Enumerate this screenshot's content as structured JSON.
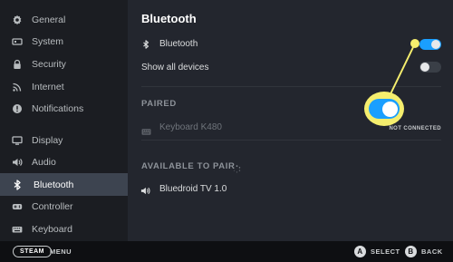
{
  "sidebar": {
    "items": [
      {
        "label": "General",
        "icon": "gear-icon",
        "active": false
      },
      {
        "label": "System",
        "icon": "system-icon",
        "active": false
      },
      {
        "label": "Security",
        "icon": "lock-icon",
        "active": false
      },
      {
        "label": "Internet",
        "icon": "wifi-icon",
        "active": false
      },
      {
        "label": "Notifications",
        "icon": "notification-icon",
        "active": false
      },
      {
        "label": "Display",
        "icon": "monitor-icon",
        "active": false
      },
      {
        "label": "Audio",
        "icon": "speaker-icon",
        "active": false
      },
      {
        "label": "Bluetooth",
        "icon": "bluetooth-icon",
        "active": true
      },
      {
        "label": "Controller",
        "icon": "gamepad-icon",
        "active": false
      },
      {
        "label": "Keyboard",
        "icon": "keyboard-icon",
        "active": false
      }
    ]
  },
  "main": {
    "title": "Bluetooth",
    "bluetooth_row": {
      "label": "Bluetooth",
      "enabled": true
    },
    "show_all_row": {
      "label": "Show all devices",
      "enabled": false
    },
    "paired": {
      "heading": "PAIRED",
      "device": {
        "name": "Keyboard K480",
        "status": "NOT CONNECTED"
      }
    },
    "available": {
      "heading": "AVAILABLE TO PAIR",
      "device": {
        "name": "Bluedroid TV 1.0"
      }
    }
  },
  "footer": {
    "steam_label": "STEAM",
    "menu_label": "MENU",
    "a_key": "A",
    "select_label": "SELECT",
    "b_key": "B",
    "back_label": "BACK"
  },
  "colors": {
    "accent": "#1a9fff",
    "highlight": "#f5ee6e",
    "sidebar_bg": "#1b1d22",
    "main_bg": "#23262e",
    "active_item_bg": "#3d4450"
  }
}
